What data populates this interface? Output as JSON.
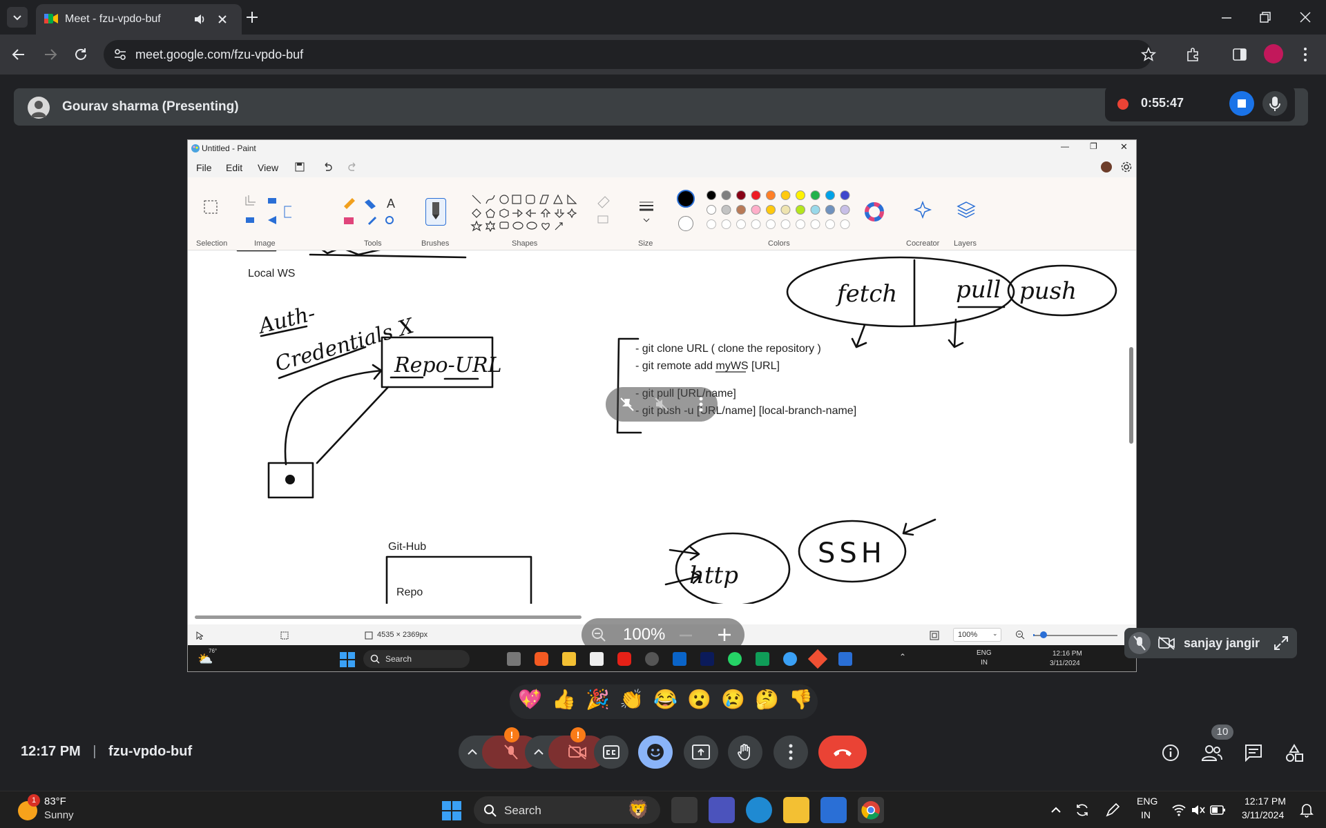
{
  "browser": {
    "tab_title": "Meet - fzu-vpdo-buf",
    "url": "meet.google.com/fzu-vpdo-buf"
  },
  "meet": {
    "presenter": "Gourav sharma (Presenting)",
    "timer": "0:55:47",
    "clock": "12:17 PM",
    "meeting_code": "fzu-vpdo-buf",
    "participant_count": "10",
    "tile_name": "sanjay jangir",
    "zoom_label": "100%",
    "reactions": [
      "💖",
      "👍",
      "🎉",
      "👏",
      "😂",
      "😮",
      "😢",
      "🤔",
      "👎"
    ]
  },
  "paint": {
    "title": "Untitled - Paint",
    "menu": [
      "File",
      "Edit",
      "View"
    ],
    "groups": [
      "Selection",
      "Image",
      "Tools",
      "Brushes",
      "Shapes",
      "Size",
      "Colors",
      "Cocreator",
      "Layers"
    ],
    "palette": [
      "#000000",
      "#7f7f7f",
      "#880015",
      "#ed1c24",
      "#ff7f27",
      "#ffc90e",
      "#fff200",
      "#22b14c",
      "#00a2e8",
      "#3f48cc",
      "#a349a4",
      "#ffffff",
      "#c3c3c3",
      "#b97a57",
      "#ffaec9",
      "#ffc90e",
      "#efe4b0",
      "#b5e61d",
      "#99d9ea",
      "#7092be",
      "#c8bfe7"
    ],
    "canvas_text": {
      "local_ws": "Local WS",
      "git_lines": [
        "- git clone URL ( clone the repository )",
        "- git remote add    myWS [URL]",
        "- git pull [URL/name]",
        "- git push -u [URL/name] [local-branch-name]"
      ],
      "github": "Git-Hub",
      "repo": "Repo",
      "hand_fetch": "fetch",
      "hand_pull": "pull",
      "hand_push": "push",
      "hand_auth": "Auth-",
      "hand_credentials": "Credentials X",
      "hand_repo_url": "Repo-URL",
      "hand_http": "http",
      "hand_ssh": "SSH"
    },
    "status_dims": "4535 × 2369px",
    "status_zoom": "100%",
    "inner_taskbar": {
      "search": "Search",
      "lang": "ENG",
      "region": "IN",
      "time": "12:16 PM",
      "date": "3/11/2024",
      "weather_temp": "76°"
    }
  },
  "taskbar": {
    "weather_temp": "83°F",
    "weather_desc": "Sunny",
    "weather_badge": "1",
    "search": "Search",
    "lang": "ENG",
    "region": "IN",
    "time": "12:17 PM",
    "date": "3/11/2024"
  }
}
